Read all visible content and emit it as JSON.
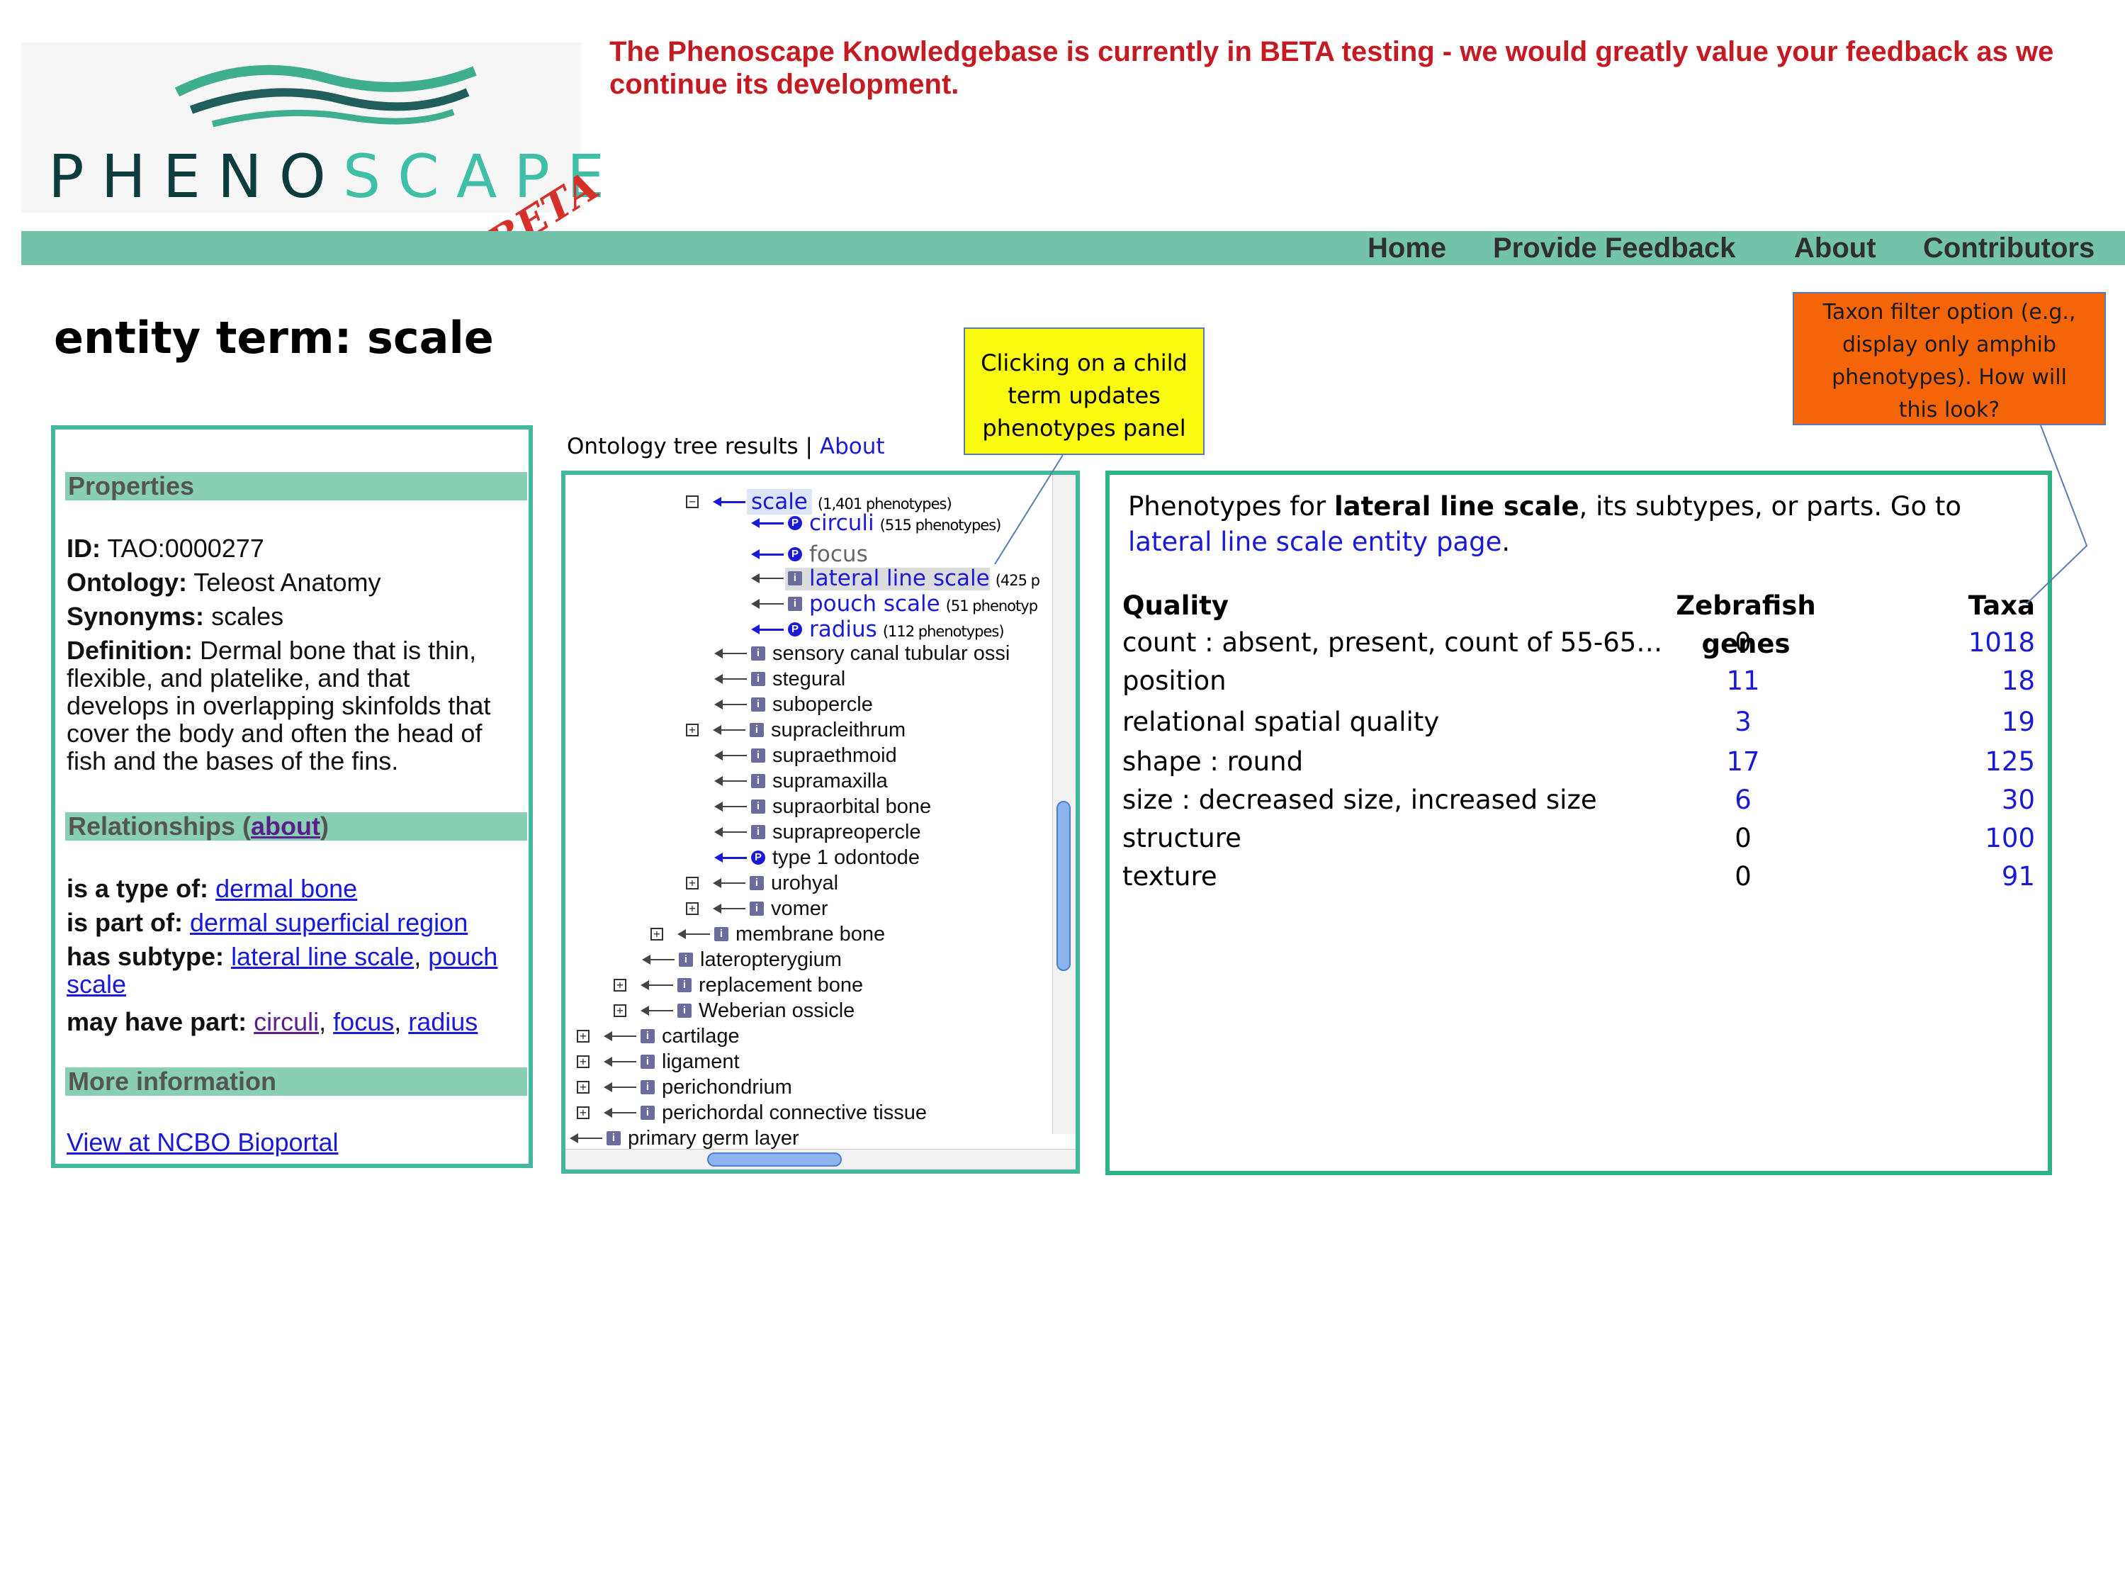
{
  "header": {
    "logo": {
      "text_dark": "PHENO",
      "text_teal": "SCAPE",
      "beta": "BETA"
    },
    "beta_message": "The Phenoscape Knowledgebase is currently in BETA testing - we would greatly value your feedback as we continue its development.",
    "nav": [
      "Home",
      "Provide Feedback",
      "About",
      "Contributors"
    ]
  },
  "page_title": "entity term: scale",
  "properties": {
    "heading": "Properties",
    "id_label": "ID:",
    "id_value": "TAO:0000277",
    "ontology_label": "Ontology:",
    "ontology_value": "Teleost Anatomy",
    "synonyms_label": "Synonyms:",
    "synonyms_value": "scales",
    "definition_label": "Definition:",
    "definition_lines": [
      "Dermal bone that is thin,",
      "flexible, and platelike, and that",
      "develops in overlapping skinfolds that",
      "cover the body and often the head of",
      "fish and the bases of the fins."
    ],
    "relationships_heading": "Relationships (",
    "relationships_about": "about",
    "relationships_close": ")",
    "type_of_label": "is a type of:",
    "type_of_link": "dermal bone",
    "part_of_label": "is part of:",
    "part_of_link": "dermal superficial region",
    "subtype_label": "has subtype:",
    "subtype_link_1": "lateral line scale",
    "subtype_sep": ",",
    "subtype_link_2a": "pouch",
    "subtype_link_2b": "scale",
    "may_have_label": "may have part:",
    "may_have_1": "circuli",
    "may_have_2": "focus",
    "may_have_3": "radius",
    "sep": ",",
    "more_heading": "More information",
    "ncbo_link": "View at NCBO Bioportal"
  },
  "tree": {
    "header_text": "Ontology tree results |",
    "header_link": "About",
    "rows": [
      {
        "label": "scale",
        "count": "(1,401 phenotypes)"
      },
      {
        "label": "circuli",
        "count": "(515 phenotypes)"
      },
      {
        "label": "focus"
      },
      {
        "label": "lateral line scale",
        "count": "(425 p"
      },
      {
        "label": "pouch scale",
        "count": "(51 phenotyp"
      },
      {
        "label": "radius",
        "count": "(112 phenotypes)"
      },
      {
        "label": "sensory canal tubular ossi"
      },
      {
        "label": "stegural"
      },
      {
        "label": "subopercle"
      },
      {
        "label": "supracleithrum"
      },
      {
        "label": "supraethmoid"
      },
      {
        "label": "supramaxilla"
      },
      {
        "label": "supraorbital bone"
      },
      {
        "label": "suprapreopercle"
      },
      {
        "label": "type 1 odontode"
      },
      {
        "label": "urohyal"
      },
      {
        "label": "vomer"
      },
      {
        "label": "membrane bone"
      },
      {
        "label": "lateropterygium"
      },
      {
        "label": "replacement bone"
      },
      {
        "label": "Weberian ossicle"
      },
      {
        "label": "cartilage"
      },
      {
        "label": "ligament"
      },
      {
        "label": "perichondrium"
      },
      {
        "label": "perichordal connective tissue"
      },
      {
        "label": "primary germ layer"
      }
    ]
  },
  "phenotypes": {
    "intro_prefix": "Phenotypes for ",
    "intro_term": "lateral line scale",
    "intro_mid": ", its subtypes, or parts. Go to ",
    "intro_link": "lateral line scale entity page",
    "intro_end": ".",
    "columns": [
      "Quality",
      "Zebrafish genes",
      "Taxa"
    ],
    "rows": [
      {
        "quality": "count : absent, present, count of 55-65…",
        "genes": "0",
        "taxa": "1018"
      },
      {
        "quality": "position",
        "genes": "11",
        "taxa": "18"
      },
      {
        "quality": "relational spatial quality",
        "genes": "3",
        "taxa": "19"
      },
      {
        "quality": "shape : round",
        "genes": "17",
        "taxa": "125"
      },
      {
        "quality": "size : decreased size, increased size",
        "genes": "6",
        "taxa": "30"
      },
      {
        "quality": "structure",
        "genes": "0",
        "taxa": "100"
      },
      {
        "quality": "texture",
        "genes": "0",
        "taxa": "91"
      }
    ]
  },
  "callouts": {
    "yellow": [
      "Clicking on a child",
      "term updates",
      "phenotypes panel"
    ],
    "orange": [
      "Taxon filter option (e.g.,",
      "display only amphib",
      "phenotypes). How will",
      "this look?"
    ]
  },
  "colors": {
    "teal": "#72c3a9",
    "panel_border": "#44b89c",
    "link": "#1a1ad6",
    "beta_red": "#c41a22"
  }
}
